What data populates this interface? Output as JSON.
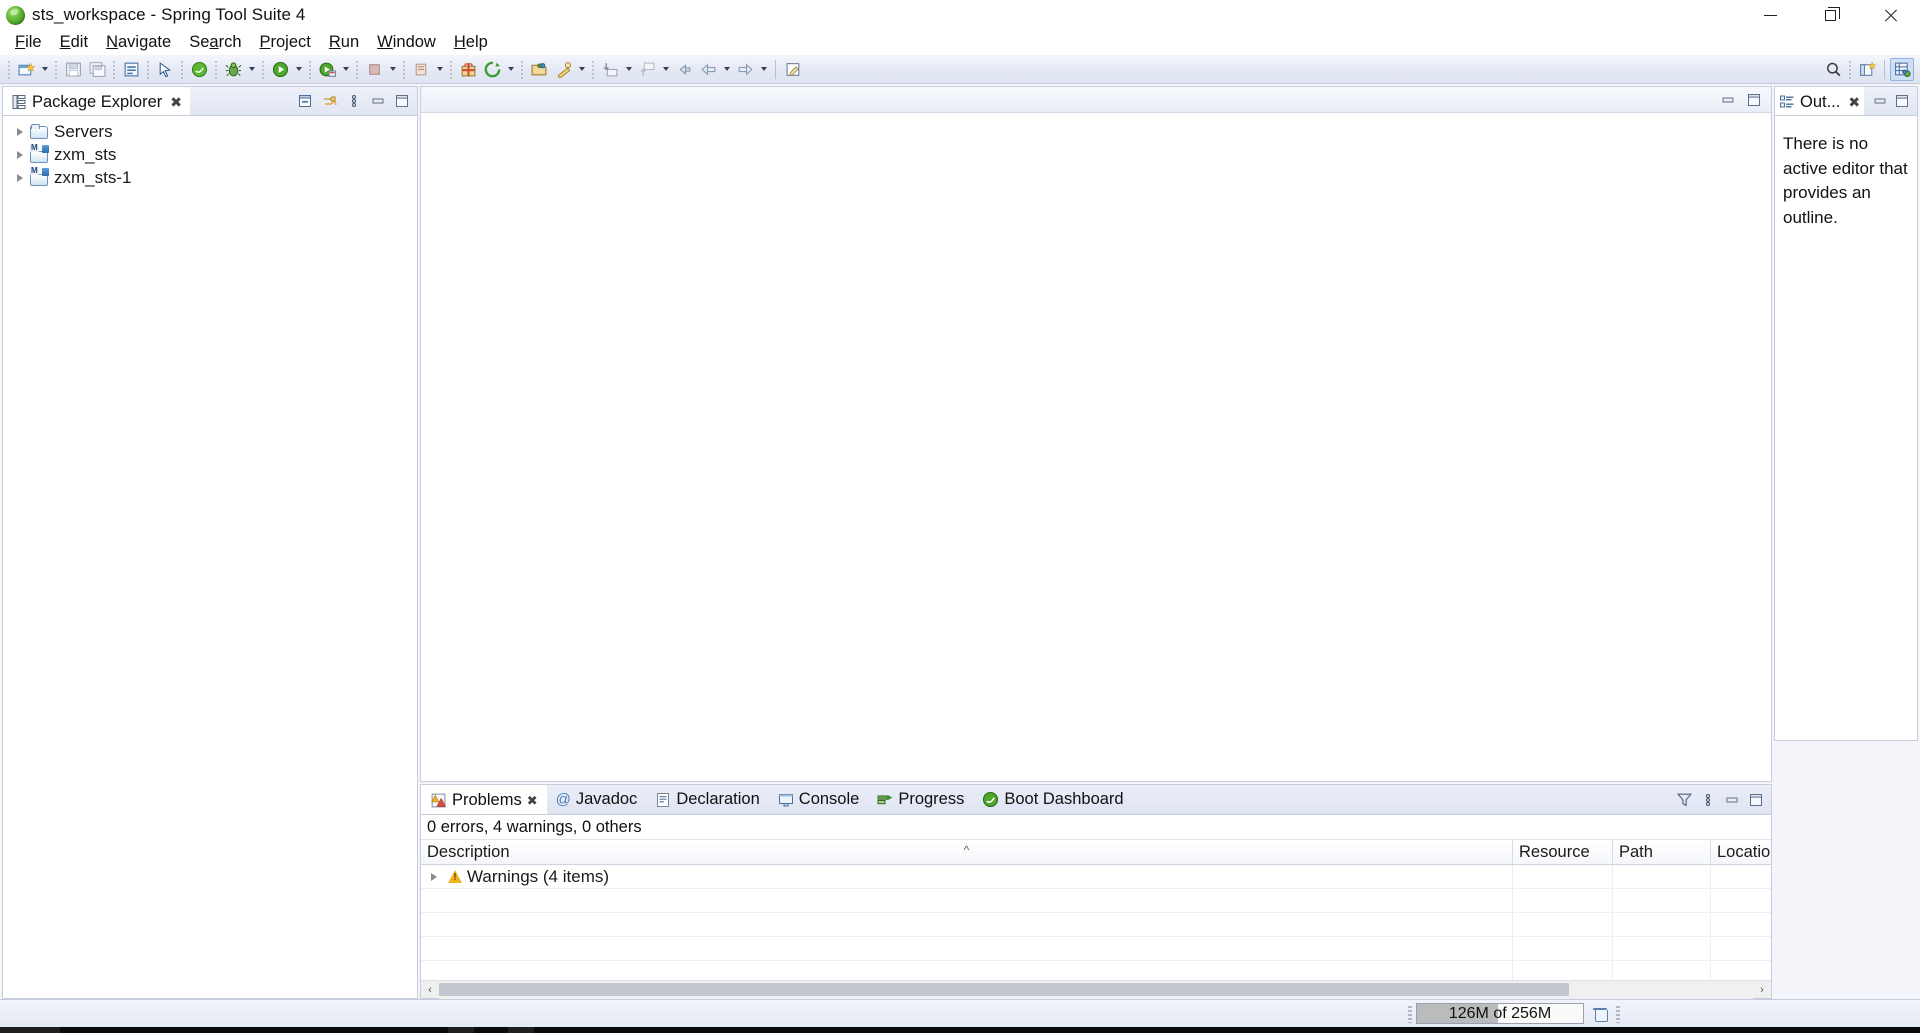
{
  "window": {
    "title": "sts_workspace - Spring Tool Suite 4",
    "app_icon": "spring-leaf-icon",
    "buttons": {
      "minimize": "minimize-icon",
      "restore": "restore-icon",
      "close": "close-icon"
    }
  },
  "menubar": {
    "items": [
      {
        "label": "File",
        "mnemonic": "F"
      },
      {
        "label": "Edit",
        "mnemonic": "E"
      },
      {
        "label": "Navigate",
        "mnemonic": "N"
      },
      {
        "label": "Search",
        "mnemonic": "a"
      },
      {
        "label": "Project",
        "mnemonic": "P"
      },
      {
        "label": "Run",
        "mnemonic": "R"
      },
      {
        "label": "Window",
        "mnemonic": "W"
      },
      {
        "label": "Help",
        "mnemonic": "H"
      }
    ]
  },
  "toolbar": {
    "items": [
      {
        "name": "new-wizard",
        "icon": "new-file-icon",
        "has_arrow": true
      },
      {
        "name": "save",
        "icon": "save-icon",
        "has_arrow": false
      },
      {
        "name": "save-all",
        "icon": "save-all-icon",
        "has_arrow": false
      },
      {
        "name": "new-java-class",
        "icon": "java-class-icon",
        "has_arrow": false
      },
      {
        "name": "link-editor",
        "icon": "link-pointer-icon",
        "has_arrow": false
      },
      {
        "name": "spring-boot-run",
        "icon": "spring-boot-icon",
        "has_arrow": false
      },
      {
        "name": "debug",
        "icon": "bug-icon",
        "has_arrow": true
      },
      {
        "name": "run",
        "icon": "run-green-icon",
        "has_arrow": true
      },
      {
        "name": "run-as-server",
        "icon": "run-server-icon",
        "has_arrow": true
      },
      {
        "name": "stop",
        "icon": "stop-icon",
        "has_arrow": true
      },
      {
        "name": "coverage",
        "icon": "coverage-icon",
        "has_arrow": true
      },
      {
        "name": "new-spring-starter",
        "icon": "spring-starter-icon",
        "has_arrow": false
      },
      {
        "name": "refresh-boot",
        "icon": "refresh-circle-icon",
        "has_arrow": true
      },
      {
        "name": "open-type",
        "icon": "open-package-icon",
        "has_arrow": false
      },
      {
        "name": "external-tools",
        "icon": "wrench-icon",
        "has_arrow": true
      },
      {
        "name": "next-annotation",
        "icon": "next-annotation-icon",
        "has_arrow": true
      },
      {
        "name": "previous-annotation",
        "icon": "previous-annotation-icon",
        "has_arrow": true
      },
      {
        "name": "back-history",
        "icon": "back-arrow-icon",
        "has_arrow": false
      },
      {
        "name": "back",
        "icon": "left-arrow-icon",
        "has_arrow": true
      },
      {
        "name": "forward",
        "icon": "right-arrow-icon",
        "has_arrow": true
      },
      {
        "name": "new-editor",
        "icon": "new-editor-icon",
        "has_arrow": false
      }
    ],
    "right_items": [
      {
        "name": "quick-access-search",
        "icon": "search-icon"
      },
      {
        "name": "open-perspective",
        "icon": "open-perspective-icon"
      },
      {
        "name": "perspective-java-ee",
        "icon": "perspective-active-icon"
      }
    ]
  },
  "package_explorer": {
    "tab_label": "Package Explorer",
    "tab_icon": "package-explorer-icon",
    "close_glyph": "✖",
    "toolbar": [
      {
        "name": "collapse-all",
        "icon": "collapse-all-icon"
      },
      {
        "name": "link-with-editor",
        "icon": "link-with-editor-icon"
      },
      {
        "name": "view-menu",
        "icon": "view-menu-icon"
      },
      {
        "name": "minimize-view",
        "icon": "minimize-icon"
      },
      {
        "name": "maximize-view",
        "icon": "maximize-icon"
      }
    ],
    "tree": [
      {
        "label": "Servers",
        "icon": "folder-icon",
        "expanded": false
      },
      {
        "label": "zxm_sts",
        "icon": "maven-java-project-icon",
        "expanded": false
      },
      {
        "label": "zxm_sts-1",
        "icon": "maven-java-project-icon",
        "expanded": false
      }
    ]
  },
  "editor": {
    "empty": true,
    "toolbar": [
      {
        "name": "minimize-editor-area",
        "icon": "minimize-icon"
      },
      {
        "name": "maximize-editor-area",
        "icon": "maximize-icon"
      }
    ]
  },
  "outline": {
    "tab_label": "Out...",
    "tab_icon": "outline-icon",
    "close_glyph": "✖",
    "message": "There is no active editor that provides an outline.",
    "toolbar": [
      {
        "name": "minimize-view",
        "icon": "minimize-icon"
      },
      {
        "name": "maximize-view",
        "icon": "maximize-icon"
      }
    ]
  },
  "bottom_panel": {
    "tabs": [
      {
        "label": "Problems",
        "icon": "problems-icon",
        "active": true,
        "closeable": true
      },
      {
        "label": "Javadoc",
        "icon": "javadoc-at-icon",
        "active": false,
        "closeable": false
      },
      {
        "label": "Declaration",
        "icon": "declaration-icon",
        "active": false,
        "closeable": false
      },
      {
        "label": "Console",
        "icon": "console-icon",
        "active": false,
        "closeable": false
      },
      {
        "label": "Progress",
        "icon": "progress-icon",
        "active": false,
        "closeable": false
      },
      {
        "label": "Boot Dashboard",
        "icon": "boot-dashboard-icon",
        "active": false,
        "closeable": false
      }
    ],
    "toolbar": [
      {
        "name": "filters",
        "icon": "filter-icon"
      },
      {
        "name": "view-menu",
        "icon": "view-menu-icon"
      },
      {
        "name": "minimize-view",
        "icon": "minimize-icon"
      },
      {
        "name": "maximize-view",
        "icon": "maximize-icon"
      }
    ],
    "problems": {
      "summary": "0 errors, 4 warnings, 0 others",
      "columns": [
        "Description",
        "Resource",
        "Path",
        "Locatio"
      ],
      "sort_indicator": "^",
      "rows": [
        {
          "description": "Warnings (4 items)",
          "icon": "warning-icon",
          "expandable": true,
          "resource": "",
          "path": "",
          "location": ""
        }
      ],
      "empty_row_count": 4
    },
    "hscroll": {
      "left_arrow": "‹",
      "right_arrow": "›"
    }
  },
  "statusbar": {
    "heap": {
      "label": "126M of 256M",
      "used_percent": 49,
      "gc_button": "trash-icon"
    }
  },
  "colors": {
    "accent": "#cfe0f5",
    "toolbar_bg": "#e4e8f4",
    "tab_active_bg": "#ffffff",
    "warning": "#f0b323",
    "spring_green": "#5fb733",
    "heap_fill": "#b9bbbd"
  }
}
